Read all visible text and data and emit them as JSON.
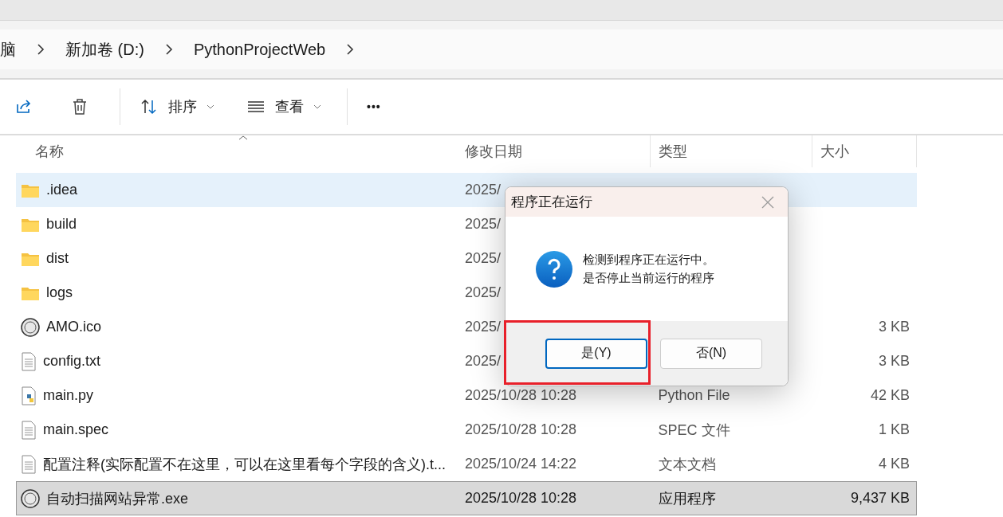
{
  "breadcrumb": [
    "脑",
    "新加卷 (D:)",
    "PythonProjectWeb"
  ],
  "toolbar": {
    "sort": "排序",
    "view": "查看",
    "more": "•••"
  },
  "table": {
    "columns": [
      "名称",
      "修改日期",
      "类型",
      "大小"
    ],
    "rows": [
      {
        "name": ".idea",
        "kind": "folder",
        "date": "2025/",
        "type": "",
        "size": "",
        "selected": false,
        "hovered": true
      },
      {
        "name": "build",
        "kind": "folder",
        "date": "2025/",
        "type": "",
        "size": "",
        "selected": false,
        "hovered": false
      },
      {
        "name": "dist",
        "kind": "folder",
        "date": "2025/",
        "type": "",
        "size": "",
        "selected": false,
        "hovered": false
      },
      {
        "name": "logs",
        "kind": "folder",
        "date": "2025/",
        "type": "",
        "size": "",
        "selected": false,
        "hovered": false
      },
      {
        "name": "AMO.ico",
        "kind": "badge",
        "date": "2025/",
        "type": "",
        "size": "3 KB",
        "selected": false,
        "hovered": false
      },
      {
        "name": "config.txt",
        "kind": "document",
        "date": "2025/",
        "type": "",
        "size": "3 KB",
        "selected": false,
        "hovered": false
      },
      {
        "name": "main.py",
        "kind": "python",
        "date": "2025/10/28 10:28",
        "type": "Python File",
        "size": "42 KB",
        "selected": false,
        "hovered": false
      },
      {
        "name": "main.spec",
        "kind": "document",
        "date": "2025/10/28 10:28",
        "type": "SPEC 文件",
        "size": "1 KB",
        "selected": false,
        "hovered": false
      },
      {
        "name": "配置注释(实际配置不在这里，可以在这里看每个字段的含义).t...",
        "kind": "document",
        "date": "2025/10/24 14:22",
        "type": "文本文档",
        "size": "4 KB",
        "selected": false,
        "hovered": false
      },
      {
        "name": "自动扫描网站异常.exe",
        "kind": "badge",
        "date": "2025/10/28 10:28",
        "type": "应用程序",
        "size": "9,437 KB",
        "selected": true,
        "hovered": false
      }
    ]
  },
  "dialog": {
    "title": "程序正在运行",
    "message": [
      "检测到程序正在运行中。",
      "是否停止当前运行的程序"
    ],
    "buttons": [
      {
        "label": "是(Y)",
        "selected": true,
        "highlighted": true
      },
      {
        "label": "否(N)",
        "selected": false,
        "highlighted": false
      }
    ]
  }
}
